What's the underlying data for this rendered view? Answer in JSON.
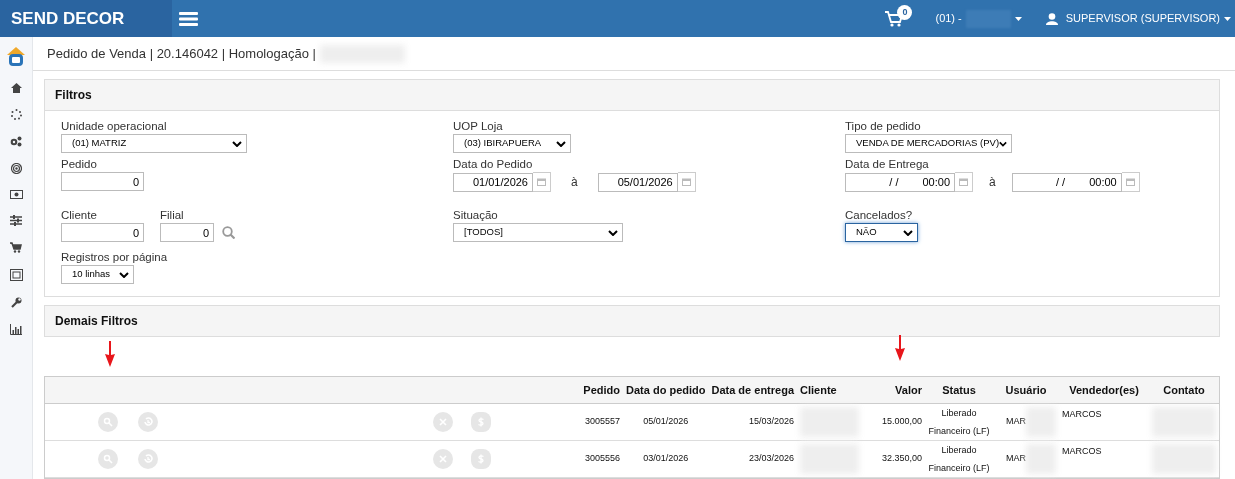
{
  "header": {
    "brand": "SEND DECOR",
    "cart_count": "0",
    "company": "(01) -",
    "user": "SUPERVISOR (SUPERVISOR)"
  },
  "breadcrumb": "Pedido de Venda | 20.146042 | Homologação |",
  "filters": {
    "title": "Filtros",
    "rows": [
      [
        [
          {
            "kind": "select",
            "label": "Unidade operacional",
            "value": "(01) MATRIZ",
            "focused": false
          }
        ],
        [
          {
            "kind": "select",
            "label": "UOP Loja",
            "value": "(03) IBIRAPUERA",
            "focused": false
          }
        ],
        [
          {
            "kind": "select",
            "label": "Tipo de pedido",
            "value": "VENDA DE MERCADORIAS (PV)",
            "focused": false
          }
        ]
      ],
      [
        [
          {
            "kind": "input",
            "label": "Pedido",
            "value": "0"
          }
        ],
        [
          {
            "kind": "daterange",
            "label": "Data do Pedido",
            "from": "01/01/2026",
            "separator": "à",
            "to": "05/01/2026"
          }
        ],
        [
          {
            "kind": "datetimerange",
            "label": "Data de Entrega",
            "from_date": "/ /",
            "from_time": "00:00",
            "separator": "à",
            "to_date": "/ /",
            "to_time": "00:00"
          }
        ]
      ],
      [
        [
          {
            "kind": "input",
            "label": "Cliente",
            "value": "0"
          },
          {
            "kind": "searchinput",
            "label": "Filial",
            "value": "0"
          }
        ],
        [
          {
            "kind": "select",
            "label": "Situação",
            "value": "[TODOS]",
            "focused": false
          }
        ],
        [
          {
            "kind": "select",
            "label": "Cancelados?",
            "value": "NÃO",
            "focused": true
          }
        ]
      ],
      [
        [
          {
            "kind": "select",
            "label": "Registros por página",
            "value": "10 linhas",
            "focused": false
          }
        ],
        [],
        []
      ]
    ]
  },
  "more_filters": {
    "title": "Demais Filtros"
  },
  "table": {
    "columns": [
      "Pedido",
      "Data do pedido",
      "Data de entrega",
      "Cliente",
      "Valor",
      "Status",
      "Usuário",
      "Vendedor(es)",
      "Contato"
    ],
    "rows": [
      {
        "pedido": "3005557",
        "data_pedido": "05/01/2026",
        "data_entrega": "15/03/2026",
        "valor": "15.000,00",
        "status": "Liberado Financeiro (LF)",
        "usuario": "MAR",
        "vendedor": "MARCOS"
      },
      {
        "pedido": "3005556",
        "data_pedido": "03/01/2026",
        "data_entrega": "23/03/2026",
        "valor": "32.350,00",
        "status": "Liberado Financeiro (LF)",
        "usuario": "MAR",
        "vendedor": "MARCOS"
      }
    ]
  }
}
